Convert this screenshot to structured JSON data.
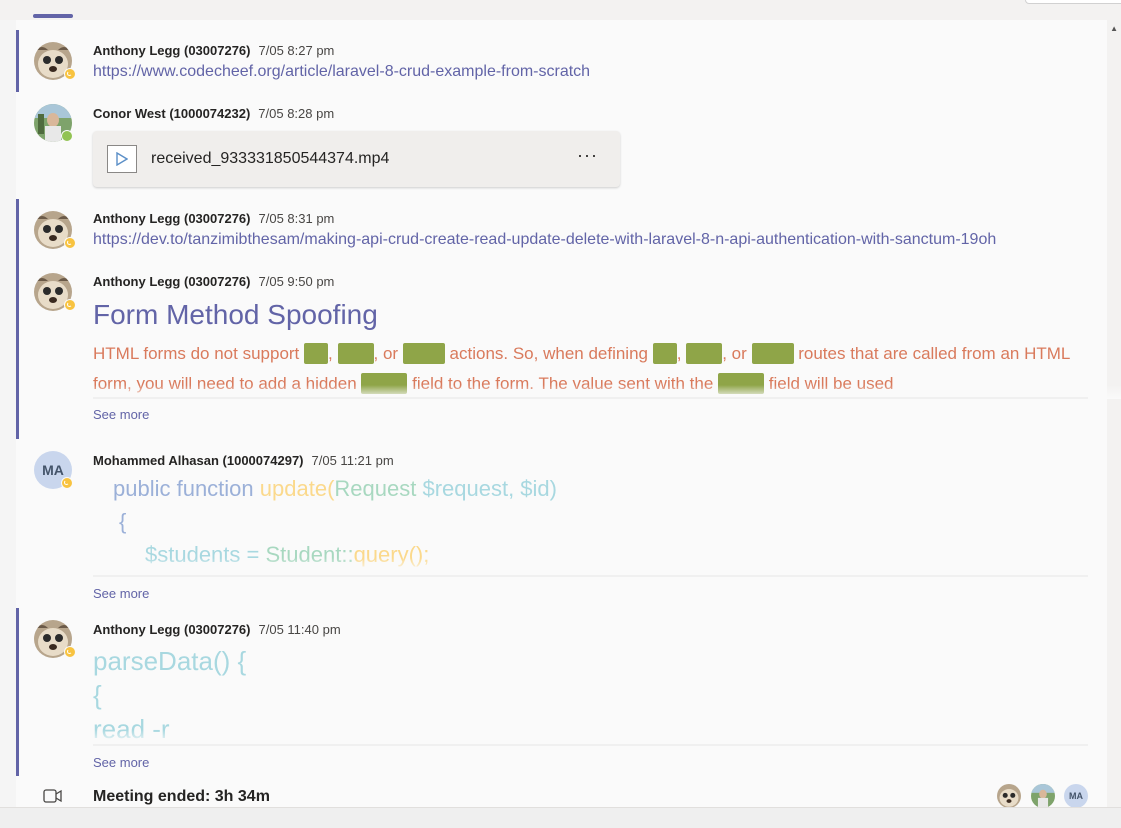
{
  "messages": [
    {
      "author": "Anthony Legg (03007276)",
      "time": "7/05 8:27 pm",
      "link": "https://www.codecheef.org/article/laravel-8-crud-example-from-scratch",
      "status": "away"
    },
    {
      "author": "Conor West (1000074232)",
      "time": "7/05 8:28 pm",
      "file": {
        "name": "received_933331850544374.mp4",
        "more": "···"
      },
      "status": "available"
    },
    {
      "author": "Anthony Legg (03007276)",
      "time": "7/05 8:31 pm",
      "link": "https://dev.to/tanzimibthesam/making-api-crud-create-read-update-delete-with-laravel-8-n-api-authentication-with-sanctum-19oh",
      "status": "away"
    },
    {
      "author": "Anthony Legg (03007276)",
      "time": "7/05 9:50 pm",
      "heading": "Form Method Spoofing",
      "para": {
        "t1": "HTML forms do not support",
        "t2": ",",
        "t3": ", or",
        "t4": "actions. So, when defining",
        "t5": ",",
        "t6": ", or",
        "t7": "routes that are called from",
        "t8": "an HTML form, you will need to add a hidden",
        "t9": "field to the form. The value sent with the",
        "t10": "field will be used"
      },
      "see_more": "See more",
      "status": "away"
    },
    {
      "author": "Mohammed Alhasan (1000074297)",
      "time": "7/05 11:21 pm",
      "initials": "MA",
      "code": {
        "l1_kw": "public function ",
        "l1_fn": "update",
        "l1_open": "(",
        "l1_ty": "Request ",
        "l1_var": "$request, $id",
        "l1_close": ")",
        "l2": "{",
        "l3_var": "$students = ",
        "l3_ty": "Student",
        "l3_sep": "::",
        "l3_fn": "query",
        "l3_end": "();"
      },
      "see_more": "See more",
      "status": "away"
    },
    {
      "author": "Anthony Legg (03007276)",
      "time": "7/05 11:40 pm",
      "code": {
        "l1": "parseData() {",
        "l2": "{",
        "l3": "read -r"
      },
      "see_more": "See more",
      "status": "away"
    }
  ],
  "meeting": {
    "text": "Meeting ended: 3h 34m",
    "participants_initials": "MA"
  },
  "colors": {
    "accent": "#6264a7",
    "away": "#f8c340",
    "available": "#92c353",
    "text_orange": "#d97a5c",
    "highlight": "#8fa548"
  }
}
